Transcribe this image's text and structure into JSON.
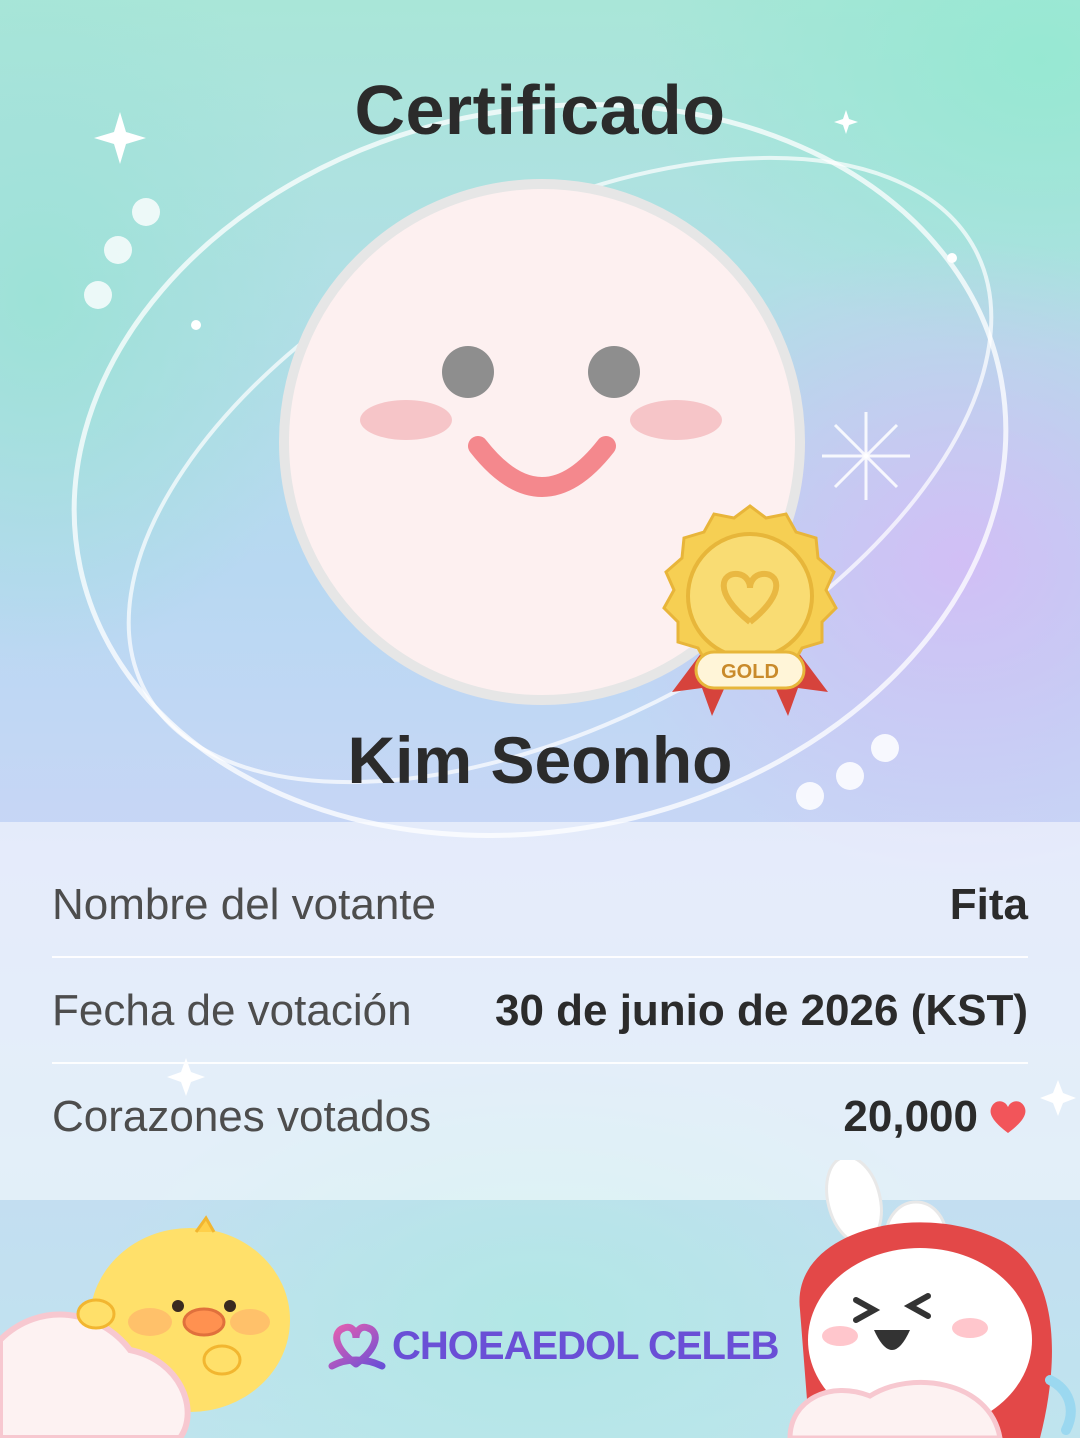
{
  "header": {
    "title": "Certificado"
  },
  "profile": {
    "name": "Kim Seonho",
    "badge_text": "GOLD"
  },
  "details": {
    "voter_label": "Nombre del votante",
    "voter_value": "Fita",
    "date_label": "Fecha de votación",
    "date_value": "30 de junio de 2026 (KST)",
    "hearts_label": "Corazones votados",
    "hearts_value": "20,000"
  },
  "brand": {
    "name": "CHOEAEDOL CELEB"
  },
  "colors": {
    "heart": "#f2555a",
    "brand": "#6a4fd6",
    "medal": "#f4c84a"
  }
}
